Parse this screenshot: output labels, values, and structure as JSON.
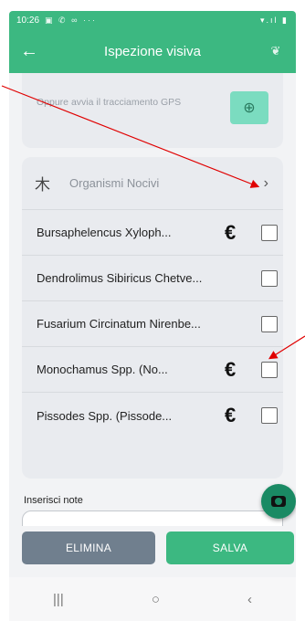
{
  "statusbar": {
    "time": "10:26",
    "left_icons": "▣ ✆ ∞ ···",
    "right_icons": "▾.ıl ▮"
  },
  "appbar": {
    "title": "Ispezione visiva",
    "back_glyph": "←",
    "plant_glyph": "❦"
  },
  "gps": {
    "text": "Oppure avvia il tracciamento GPS",
    "button_glyph": "⊕"
  },
  "pests": {
    "header": "Organismi Nocivi",
    "bug_glyph": "⽊",
    "chevron": "›",
    "items": [
      {
        "name": "Bursaphelencus Xyloph...",
        "euro": "€"
      },
      {
        "name": "Dendrolimus Sibiricus Chetve...",
        "euro": ""
      },
      {
        "name": "Fusarium Circinatum Nirenbe...",
        "euro": ""
      },
      {
        "name": "Monochamus Spp. (No...",
        "euro": "€"
      },
      {
        "name": "Pissodes Spp. (Pissode...",
        "euro": "€"
      }
    ]
  },
  "notes": {
    "label": "Inserisci note",
    "value": ""
  },
  "actions": {
    "delete_label": "ELIMINA",
    "save_label": "SALVA"
  },
  "navbar": {
    "recents": "|||",
    "home": "○",
    "back": "‹"
  },
  "colors": {
    "primary": "#3cb881",
    "delete": "#707f8e",
    "camera": "#1a8a64",
    "annotation": "#e00000"
  }
}
